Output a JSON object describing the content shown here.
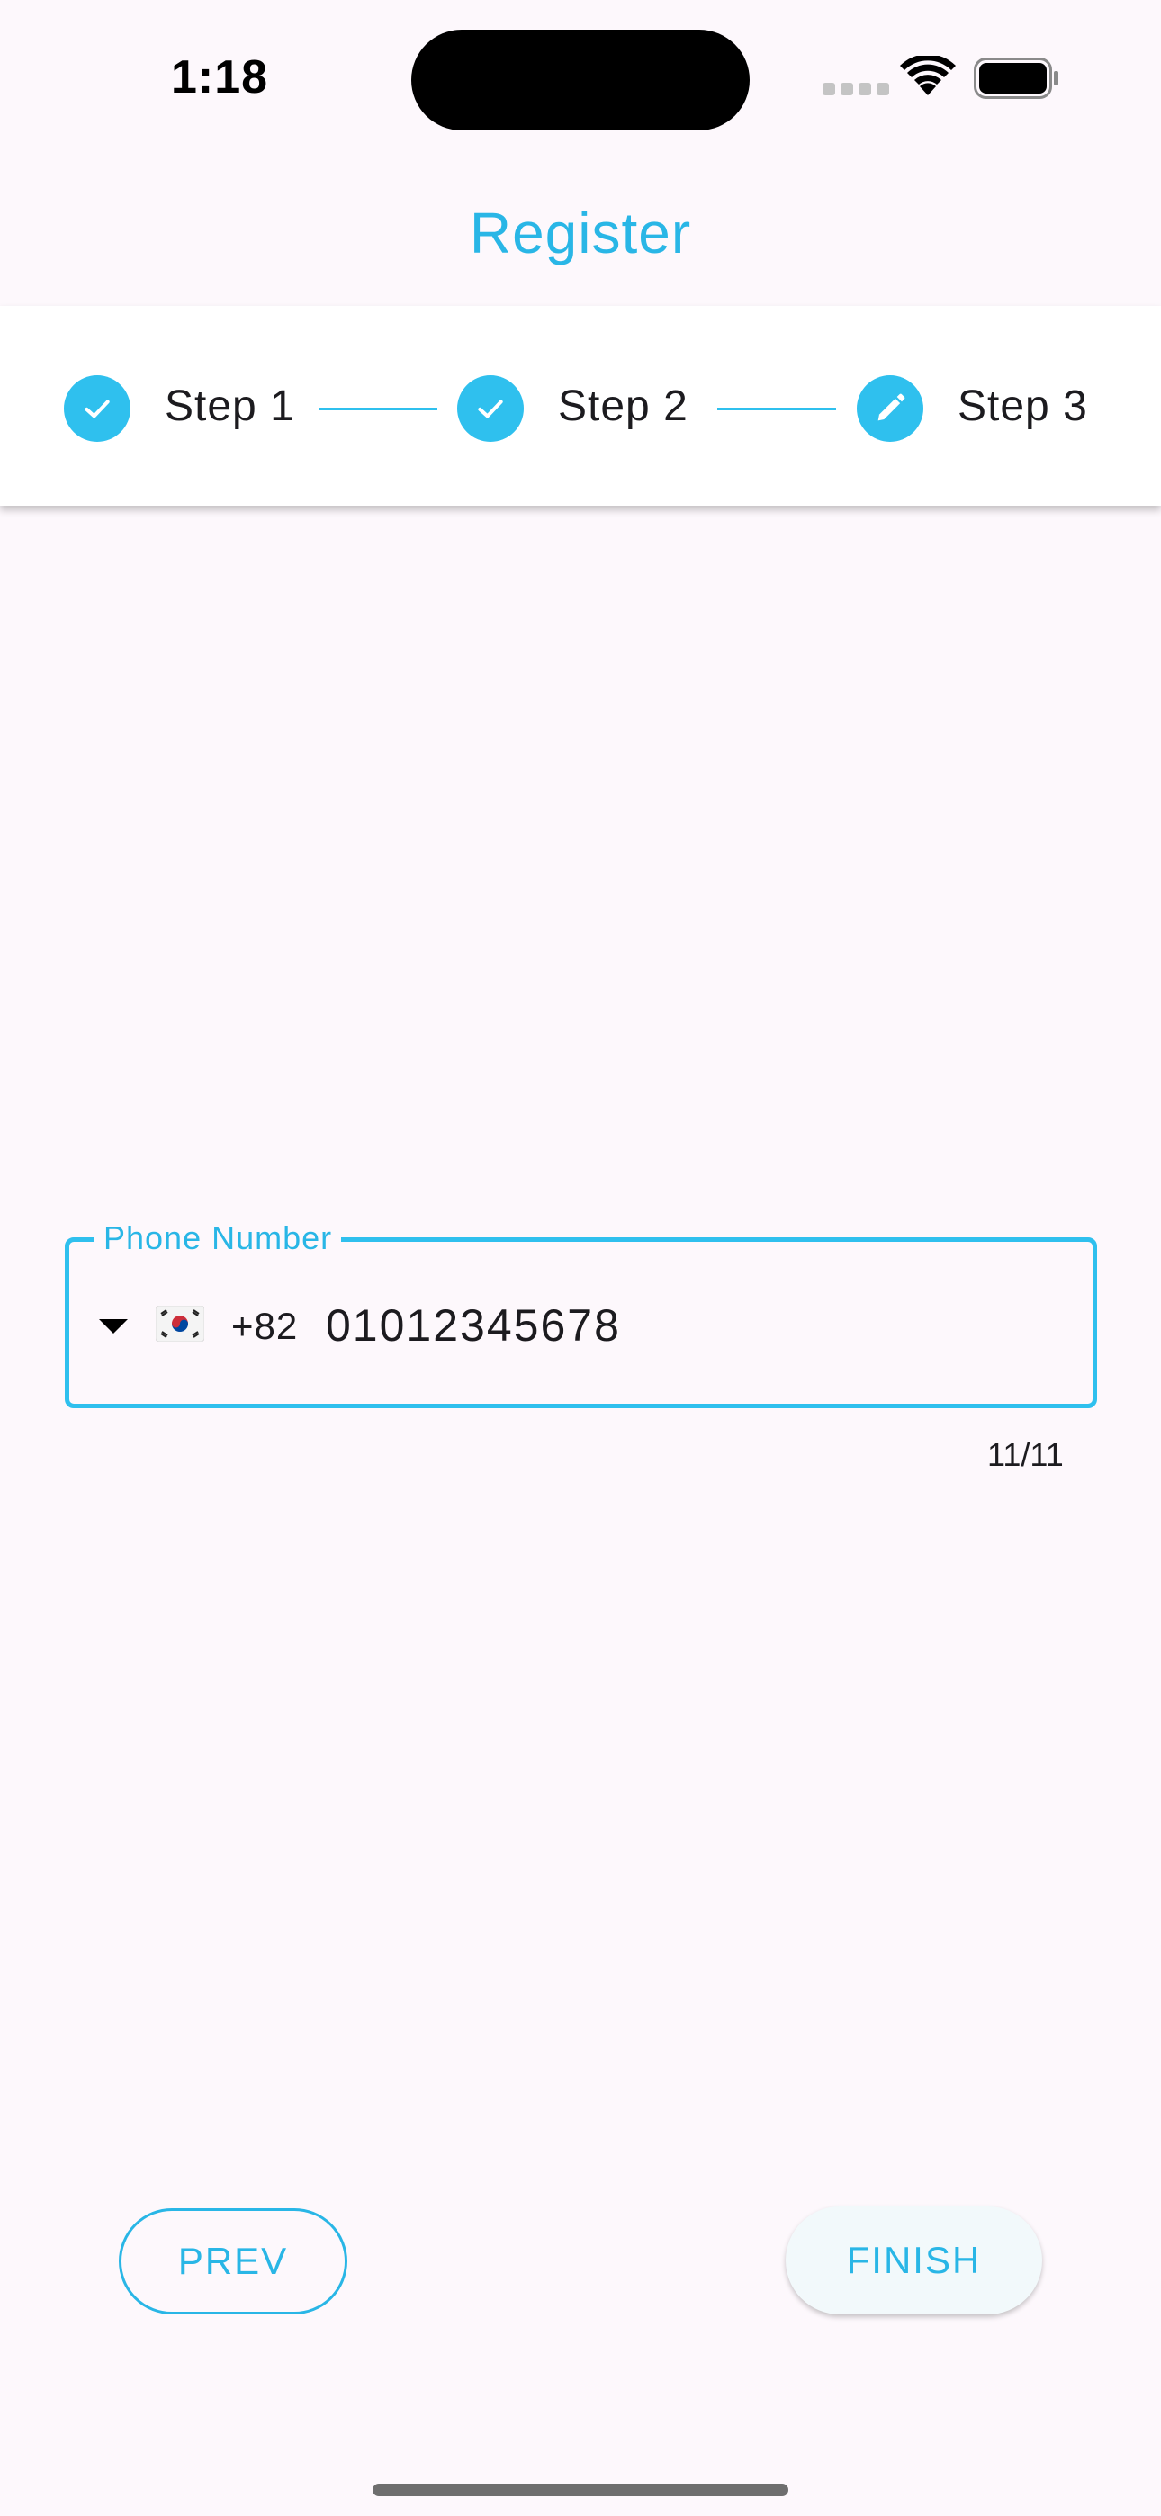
{
  "status_bar": {
    "time": "1:18"
  },
  "header": {
    "title": "Register"
  },
  "stepper": {
    "accent_color": "#2fc0ee",
    "steps": [
      {
        "label": "Step 1",
        "state": "completed",
        "icon": "check-icon"
      },
      {
        "label": "Step 2",
        "state": "completed",
        "icon": "check-icon"
      },
      {
        "label": "Step 3",
        "state": "editing",
        "icon": "pencil-icon"
      }
    ]
  },
  "phone_field": {
    "label": "Phone Number",
    "country_flag": "south-korea-flag-icon",
    "dial_code": "+82",
    "value": "01012345678",
    "counter": "11/11"
  },
  "buttons": {
    "prev_label": "PREV",
    "finish_label": "FINISH"
  }
}
